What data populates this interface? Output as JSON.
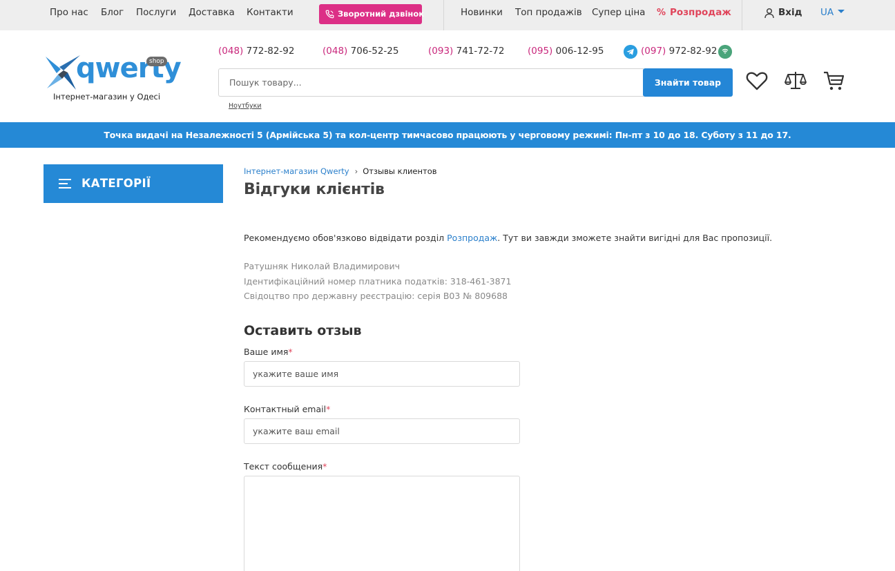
{
  "topbar": {
    "nav": [
      "Про нас",
      "Блог",
      "Послуги",
      "Доставка",
      "Контакти"
    ],
    "callback_label": "Зворотний дзвінок",
    "callback_color": "#dc2f86",
    "catalog_links": [
      "Новинки",
      "Топ продажів",
      "Супер ціна"
    ],
    "sale_label": "Розпродаж",
    "sale_icon": "%",
    "sale_color": "#e0455b",
    "login_label": "Вхід",
    "language": "UA"
  },
  "header": {
    "logo": {
      "word": "qwerty",
      "badge": "shop",
      "tagline": "Інтернет-магазин у Одесі"
    },
    "phones": [
      {
        "code": "(048)",
        "number": " 772-82-92"
      },
      {
        "code": "(048)",
        "number": " 706-52-25"
      },
      {
        "code": "(093)",
        "number": " 741-72-72"
      },
      {
        "code": "(095)",
        "number": " 006-12-95"
      },
      {
        "code": "(097)",
        "number": " 972-82-92"
      }
    ],
    "search": {
      "placeholder": "Пошук товару...",
      "button_label": "Знайти товар",
      "hint": "Ноутбуки"
    },
    "icons": [
      "heart-icon",
      "scales-icon",
      "cart-icon"
    ],
    "accent_color": "#2486d6"
  },
  "notice": {
    "text": "Точка видачі на Незалежності 5 (Армійська 5) та кол-центр тимчасово працюють у черговому режимі: Пн-пт з 10 до 18. Суботу з 11 до 17.",
    "color": "#2589d6"
  },
  "sidebar": {
    "categories_label": "КАТЕГОРІЇ"
  },
  "main": {
    "breadcrumb": {
      "home": "Інтернет-магазин Qwerty",
      "current": "Отзывы клиентов"
    },
    "title": "Відгуки клієнтів",
    "recommend": {
      "before": "Рекомендуємо обов'язково відвідати розділ ",
      "link": "Розпродаж",
      "after": ". Тут ви завжди зможете знайти вигідні для Вас пропозиції."
    },
    "seller": [
      "Ратушняк Николай Владимирович",
      "Ідентифікаційний номер платника податків: 318-461-3871",
      "Свідоцтво про державну реєстрацію: серія В03 № 809688"
    ],
    "form": {
      "title": "Оставить отзыв",
      "name_label": "Ваше имя",
      "name_placeholder": "укажите ваше имя",
      "email_label": "Контактный email",
      "email_placeholder": "укажите ваш email",
      "message_label": "Текст сообщения",
      "required_mark": "*"
    }
  }
}
